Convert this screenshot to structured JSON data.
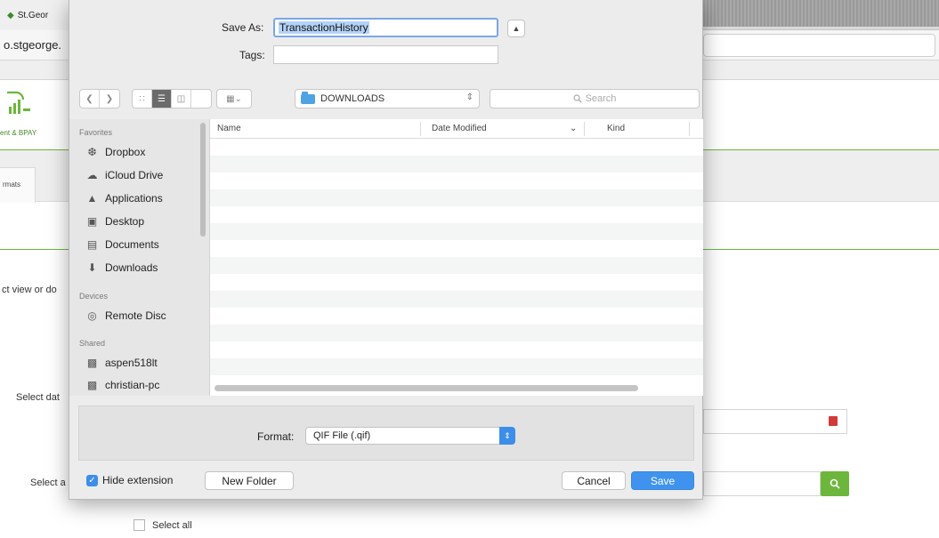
{
  "browser": {
    "tab_title": "St.Geor",
    "url_fragment": "o.stgeorge.",
    "nav_label": "ent & BPAY",
    "formats_tab": "rmats",
    "page_text_view": "ct view or do",
    "page_text_date": "Select dat",
    "page_text_account": "Select a",
    "select_all": "Select all"
  },
  "dialog": {
    "save_as_label": "Save As:",
    "save_as_value": "TransactionHistory",
    "tags_label": "Tags:",
    "tags_value": "",
    "location": "DOWNLOADS",
    "search_placeholder": "Search",
    "sidebar": {
      "favorites_heading": "Favorites",
      "favorites": [
        {
          "label": "Dropbox",
          "icon": "dropbox-icon"
        },
        {
          "label": "iCloud Drive",
          "icon": "cloud-icon"
        },
        {
          "label": "Applications",
          "icon": "applications-icon"
        },
        {
          "label": "Desktop",
          "icon": "desktop-icon"
        },
        {
          "label": "Documents",
          "icon": "documents-icon"
        },
        {
          "label": "Downloads",
          "icon": "downloads-icon"
        }
      ],
      "devices_heading": "Devices",
      "devices": [
        {
          "label": "Remote Disc",
          "icon": "disc-icon"
        }
      ],
      "shared_heading": "Shared",
      "shared": [
        {
          "label": "aspen518lt",
          "icon": "computer-icon"
        },
        {
          "label": "christian-pc",
          "icon": "computer-icon"
        }
      ]
    },
    "columns": {
      "name": "Name",
      "date_modified": "Date Modified",
      "kind": "Kind"
    },
    "format_label": "Format:",
    "format_value": "QIF File (.qif)",
    "hide_extension_label": "Hide extension",
    "hide_extension_checked": true,
    "new_folder_label": "New Folder",
    "cancel_label": "Cancel",
    "save_label": "Save"
  },
  "colors": {
    "accent_blue": "#3f93ef",
    "brand_green": "#6cb63c"
  }
}
